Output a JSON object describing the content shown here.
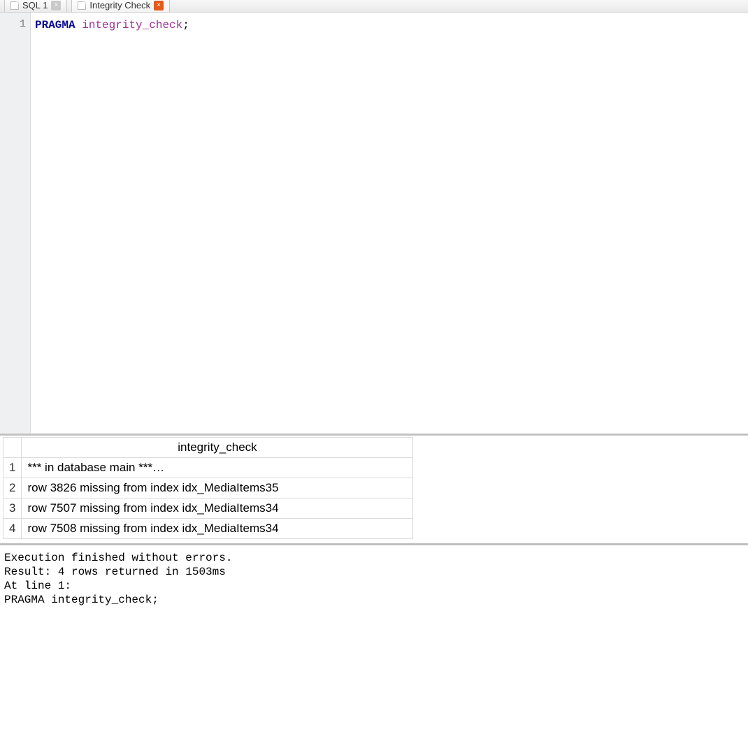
{
  "tabs": [
    {
      "label": "SQL 1",
      "dirty": false
    },
    {
      "label": "Integrity Check",
      "dirty": true
    }
  ],
  "editor": {
    "line_numbers": [
      "1"
    ],
    "tokens": {
      "keyword": "PRAGMA",
      "identifier": "integrity_check",
      "terminator": ";"
    }
  },
  "results": {
    "column_header": "integrity_check",
    "rows": [
      {
        "n": "1",
        "text": "*** in database main ***…"
      },
      {
        "n": "2",
        "text": "row 3826 missing from index idx_MediaItems35"
      },
      {
        "n": "3",
        "text": "row 7507 missing from index idx_MediaItems34"
      },
      {
        "n": "4",
        "text": "row 7508 missing from index idx_MediaItems34"
      }
    ]
  },
  "log": {
    "line1": "Execution finished without errors.",
    "line2": "Result: 4 rows returned in 1503ms",
    "line3": "At line 1:",
    "line4": "PRAGMA integrity_check;"
  }
}
